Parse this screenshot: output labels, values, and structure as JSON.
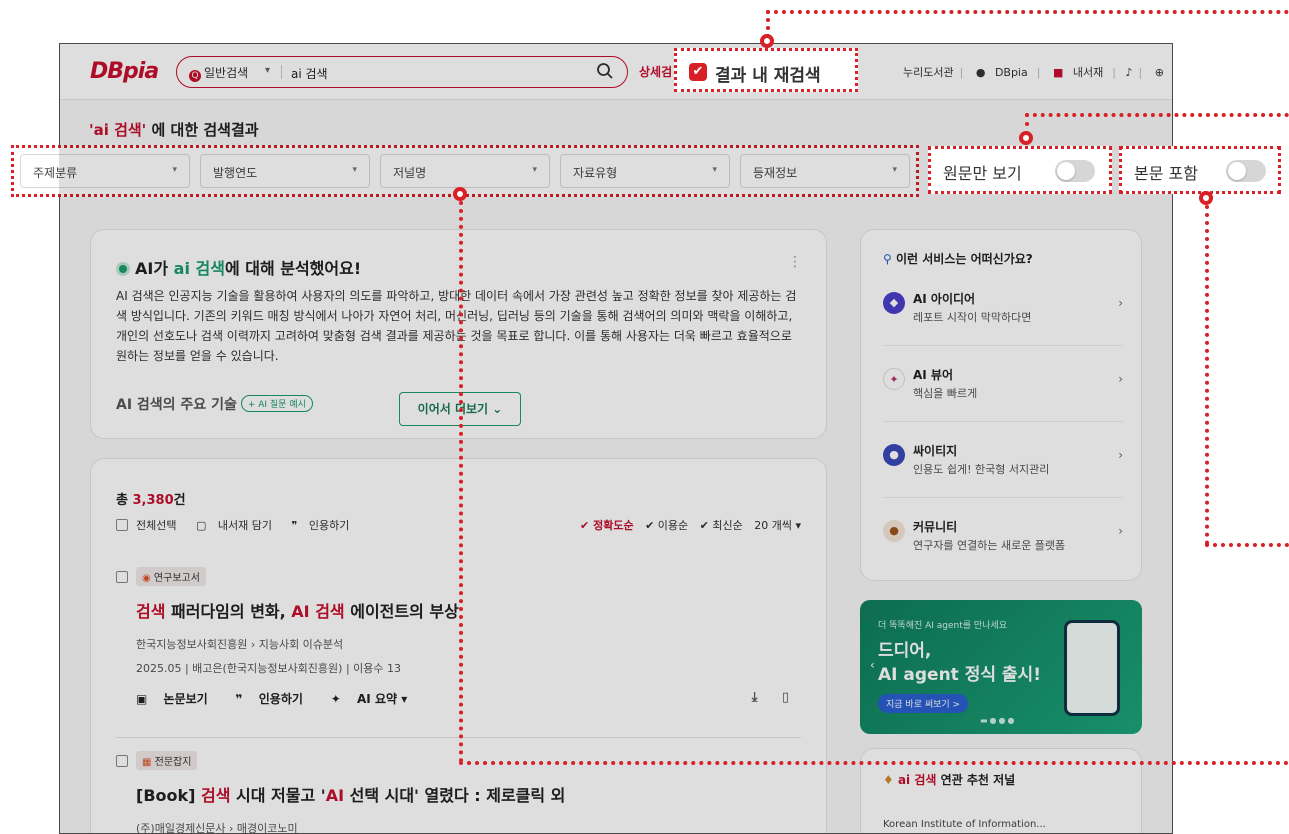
{
  "header": {
    "logo": "DBpia",
    "search_mode": "일반검색",
    "search_query": "ai 검색",
    "advanced_search": "상세검",
    "util_library": "누리도서관",
    "util_account": "DBpia",
    "util_mylib": "내서재",
    "util_lang": "EN"
  },
  "result_heading": {
    "query": "'ai 검색'",
    "suffix": " 에 대한 검색결과"
  },
  "filters": [
    "주제분류",
    "발행연도",
    "저널명",
    "자료유형",
    "등재정보"
  ],
  "highlights": {
    "search_within": "결과 내 재검색",
    "original_only": "원문만 보기",
    "include_body": "본문 포함"
  },
  "ai_card": {
    "prefix": "AI가 ",
    "query": "ai 검색",
    "suffix": "에 대해 분석했어요!",
    "body": "AI 검색은 인공지능 기술을 활용하여 사용자의 의도를 파악하고, 방대한 데이터 속에서 가장 관련성 높고 정확한 정보를 찾아 제공하는 검색 방식입니다. 기존의 키워드 매칭 방식에서 나아가 자연어 처리, 머신러닝, 딥러닝 등의 기술을 통해 검색어의 의미와 맥락을 이해하고, 개인의 선호도나 검색 이력까지 고려하여 맞춤형 검색 결과를 제공하는 것을 목표로 합니다. 이를 통해 사용자는 더욱 빠르고 효율적으로 원하는 정보를 얻을 수 있습니다.",
    "subheading": "AI 검색의 주요 기술",
    "chip": "+ AI 질문 예시",
    "more_button": "이어서 더보기 ⌄"
  },
  "results": {
    "total_prefix": "총 ",
    "total_count": "3,380",
    "total_suffix": "건",
    "select_all": "전체선택",
    "save_mylib": "내서재 담기",
    "cite": "인용하기",
    "sort_accuracy": "✔ 정확도순",
    "sort_usage": "✔ 이용순",
    "sort_latest": "✔ 최신순",
    "per_page": "20 개씩 ▾",
    "items": [
      {
        "badge": "연구보고서",
        "title_parts": [
          "검색",
          " 패러다임의 변화, ",
          "AI 검색",
          " 에이전트의 부상"
        ],
        "publisher": "한국지능정보사회진흥원 › 지능사회 이슈분석",
        "meta": "2025.05 | 배고은(한국지능정보사회진흥원) | 이용수 13",
        "act_view": "논문보기",
        "act_cite": "인용하기",
        "act_summary": "AI 요약 ▾"
      },
      {
        "badge": "전문잡지",
        "title_parts": [
          "[Book] ",
          "검색",
          " 시대 저물고 '",
          "AI",
          " 선택 시대' 열렸다 : 제로클릭 외"
        ],
        "publisher": "(주)매일경제신문사 › 매경이코노미"
      }
    ]
  },
  "services": {
    "heading": "이런 서비스는 어떠신가요?",
    "items": [
      {
        "title": "AI 아이디어",
        "desc": "레포트 시작이 막막하다면"
      },
      {
        "title": "AI 뷰어",
        "desc": "핵심을 빠르게"
      },
      {
        "title": "싸이티지",
        "desc": "인용도 쉽게! 한국형 서지관리"
      },
      {
        "title": "커뮤니티",
        "desc": "연구자를 연결하는 새로운 플랫폼"
      }
    ]
  },
  "banner": {
    "small": "더 똑똑해진 AI agent를 만나세요",
    "line1": "드디어,",
    "line2": "AI agent 정식 출시!",
    "button": "지금 바로 써보기 >"
  },
  "recommend": {
    "query": "ai 검색",
    "suffix": " 연관 추천 저널",
    "first": "Korean Institute of Information..."
  },
  "colors": {
    "brand_red": "#c8102e",
    "accent_green": "#1a9b6c",
    "highlight_red": "#d82027"
  }
}
